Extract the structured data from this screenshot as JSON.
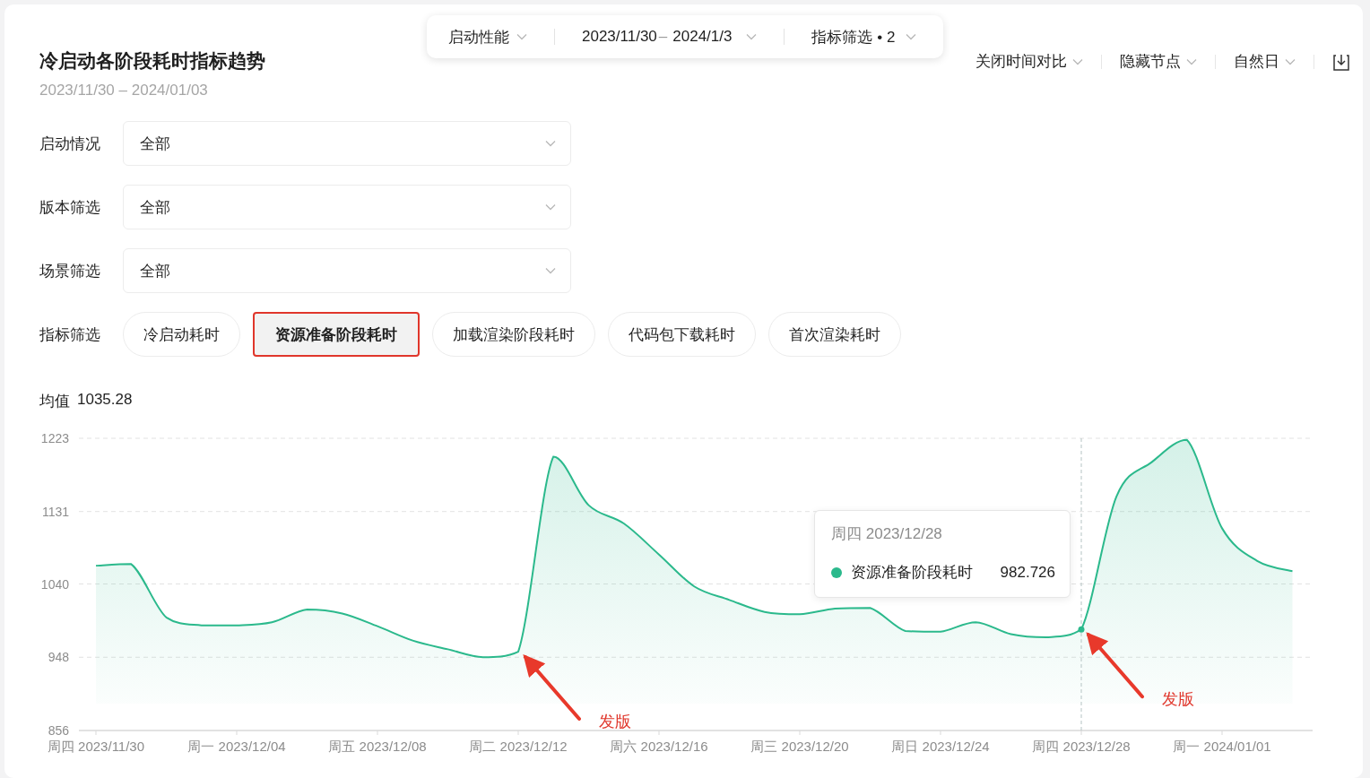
{
  "top_bar": {
    "module": "启动性能",
    "date_start": "2023/11/30",
    "date_separator": "–",
    "date_end": "2024/1/3",
    "metric_filter": "指标筛选 • 2"
  },
  "header": {
    "title": "冷启动各阶段耗时指标趋势",
    "date_range": "2023/11/30 – 2024/01/03"
  },
  "toolbar": [
    {
      "label": "关闭时间对比"
    },
    {
      "label": "隐藏节点"
    },
    {
      "label": "自然日"
    }
  ],
  "filters": [
    {
      "label": "启动情况",
      "value": "全部"
    },
    {
      "label": "版本筛选",
      "value": "全部"
    },
    {
      "label": "场景筛选",
      "value": "全部"
    }
  ],
  "metric_filter": {
    "label": "指标筛选",
    "options": [
      {
        "label": "冷启动耗时",
        "selected": false
      },
      {
        "label": "资源准备阶段耗时",
        "selected": true
      },
      {
        "label": "加载渲染阶段耗时",
        "selected": false
      },
      {
        "label": "代码包下载耗时",
        "selected": false
      },
      {
        "label": "首次渲染耗时",
        "selected": false
      }
    ]
  },
  "mean": {
    "label": "均值",
    "value": "1035.28"
  },
  "chart": {
    "chart_data": {
      "type": "area",
      "categories": [
        "周四 2023/11/30",
        null,
        null,
        null,
        "周一 2023/12/04",
        null,
        null,
        null,
        "周五 2023/12/08",
        null,
        null,
        null,
        "周二 2023/12/12",
        null,
        null,
        null,
        "周六 2023/12/16",
        null,
        null,
        null,
        "周三 2023/12/20",
        null,
        null,
        null,
        "周日 2023/12/24",
        null,
        null,
        null,
        "周四 2023/12/28",
        null,
        null,
        null,
        "周一 2024/01/01",
        null,
        null
      ],
      "series": [
        {
          "name": "资源准备阶段耗时",
          "color": "#2bb98c",
          "values": [
            1063,
            1065,
            998,
            988,
            988,
            992,
            1008,
            1003,
            987,
            969,
            958,
            948,
            955,
            1200,
            1139,
            1116,
            1077,
            1037,
            1020,
            1005,
            1002,
            1009,
            1010,
            981,
            980,
            992,
            977,
            973,
            983,
            1150,
            1193,
            1221,
            1110,
            1069,
            1056
          ]
        }
      ],
      "ylim": [
        856,
        1223
      ],
      "yticks": [
        856,
        948,
        1040,
        1131,
        1223
      ],
      "grid": true,
      "annotations": [
        "发版",
        "发版"
      ]
    },
    "tooltip": {
      "title": "周四 2023/12/28",
      "value": "982.726"
    }
  }
}
